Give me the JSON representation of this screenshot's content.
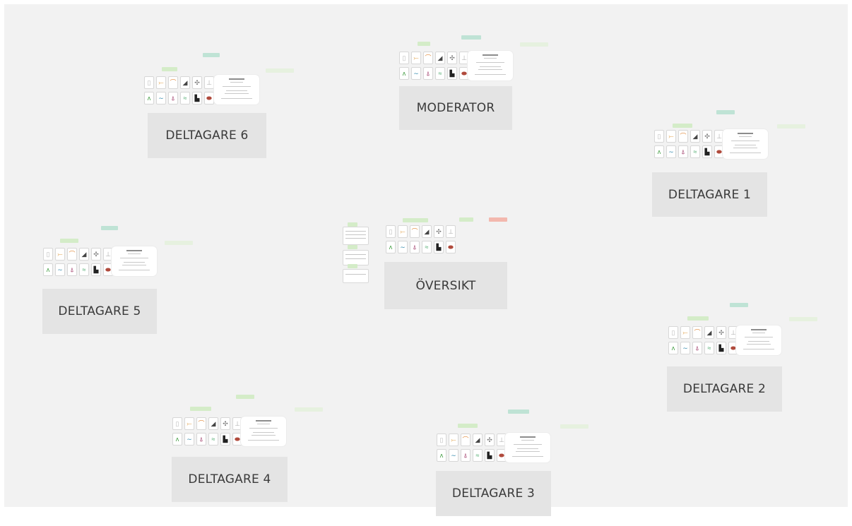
{
  "board": {
    "titles": {
      "moderator": "MODERATOR",
      "overview": "ÖVERSIKT",
      "p1": "DELTAGARE 1",
      "p2": "DELTAGARE 2",
      "p3": "DELTAGARE 3",
      "p4": "DELTAGARE 4",
      "p5": "DELTAGARE 5",
      "p6": "DELTAGARE 6"
    },
    "card_icons": [
      "page-icon",
      "fish-icon",
      "bird-icon",
      "mammal-icon",
      "insect-icon",
      "flask-icon",
      "plant-icon",
      "water-icon",
      "person-icon",
      "wave-icon",
      "factory-icon",
      "animal-icon"
    ],
    "colors": {
      "board": "#f2f2f2",
      "title_box": "#e4e4e4",
      "tag_green": "#d4ecc8",
      "tag_teal": "#bfe3d5",
      "tag_red": "#f3b8ae"
    }
  }
}
